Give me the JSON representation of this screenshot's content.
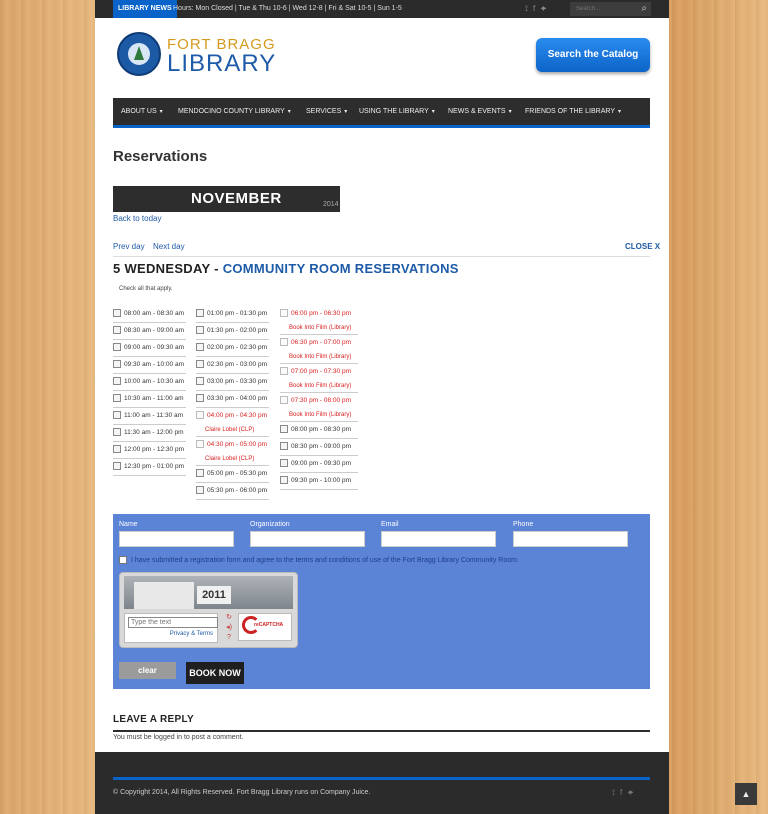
{
  "topbar": {
    "badge": "LIBRARY NEWS",
    "hours": "Hours: Mon Closed | Tue & Thu 10-6 | Wed 12-8 | Fri & Sat 10-5 | Sun 1-5",
    "search_placeholder": "Search...",
    "icons": [
      "rss-icon",
      "facebook-icon",
      "twitter-icon"
    ]
  },
  "header": {
    "logo_line1": "FORT BRAGG",
    "logo_line2": "LIBRARY",
    "catalog_button": "Search the Catalog"
  },
  "nav": {
    "items": [
      {
        "label": "ABOUT US"
      },
      {
        "label": "MENDOCINO COUNTY LIBRARY"
      },
      {
        "label": "SERVICES"
      },
      {
        "label": "USING THE LIBRARY"
      },
      {
        "label": "NEWS & EVENTS"
      },
      {
        "label": "FRIENDS OF THE LIBRARY"
      }
    ],
    "dropdown_glyph": "▾"
  },
  "page": {
    "title": "Reservations",
    "month": "NOVEMBER",
    "year": "2014",
    "back_today": "Back to today",
    "prev_day": "Prev day",
    "next_day": "Next day",
    "close": "CLOSE X",
    "day_heading": "5 WEDNESDAY - ",
    "room": "COMMUNITY ROOM RESERVATIONS",
    "check_all": "Check all that apply."
  },
  "slots": {
    "col1": [
      {
        "time": "08:00 am - 08:30 am"
      },
      {
        "time": "08:30 am - 09:00 am"
      },
      {
        "time": "09:00 am - 09:30 am"
      },
      {
        "time": "09:30 am - 10:00 am"
      },
      {
        "time": "10:00 am - 10:30 am"
      },
      {
        "time": "10:30 am - 11:00 am"
      },
      {
        "time": "11:00 am - 11:30 am"
      },
      {
        "time": "11:30 am - 12:00 pm"
      },
      {
        "time": "12:00 pm - 12:30 pm"
      },
      {
        "time": "12:30 pm - 01:00 pm"
      }
    ],
    "col2": [
      {
        "time": "01:00 pm - 01:30 pm"
      },
      {
        "time": "01:30 pm - 02:00 pm"
      },
      {
        "time": "02:00 pm - 02:30 pm"
      },
      {
        "time": "02:30 pm - 03:00 pm"
      },
      {
        "time": "03:00 pm - 03:30 pm"
      },
      {
        "time": "03:30 pm - 04:00 pm"
      },
      {
        "time": "04:00 pm - 04:30 pm",
        "reserved_by": "Claire Lobel (CLP)"
      },
      {
        "time": "04:30 pm - 05:00 pm",
        "reserved_by": "Claire Lobel (CLP)"
      },
      {
        "time": "05:00 pm - 05:30 pm"
      },
      {
        "time": "05:30 pm - 06:00 pm"
      }
    ],
    "col3": [
      {
        "time": "06:00 pm - 06:30 pm",
        "reserved_by": "Book Into Film (Library)"
      },
      {
        "time": "06:30 pm - 07:00 pm",
        "reserved_by": "Book Into Film (Library)"
      },
      {
        "time": "07:00 pm - 07:30 pm",
        "reserved_by": "Book Into Film (Library)"
      },
      {
        "time": "07:30 pm - 08:00 pm",
        "reserved_by": "Book Into Film (Library)"
      },
      {
        "time": "08:00 pm - 08:30 pm"
      },
      {
        "time": "08:30 pm - 09:00 pm"
      },
      {
        "time": "09:00 pm - 09:30 pm"
      },
      {
        "time": "09:30 pm - 10:00 pm"
      }
    ]
  },
  "form": {
    "name_label": "Name",
    "org_label": "Organization",
    "email_label": "Email",
    "phone_label": "Phone",
    "agree_text": "I have submitted a registration form and agree to the terms and conditions of use of the Fort Bragg Library Community Room.",
    "captcha_number": "2011",
    "captcha_placeholder": "Type the text",
    "privacy_terms": "Privacy & Terms",
    "captcha_brand": "reCAPTCHA",
    "clear_button": "clear",
    "book_button": "BOOK NOW"
  },
  "reply": {
    "heading": "LEAVE A REPLY",
    "note": "You must be logged in to post a comment."
  },
  "footer": {
    "copyright": "© Copyright 2014, All Rights Reserved. Fort Bragg Library runs on Company Juice."
  },
  "colors": {
    "accent": "#0a63c9",
    "reserved": "#d82020",
    "form_bg": "#5b83d6"
  }
}
